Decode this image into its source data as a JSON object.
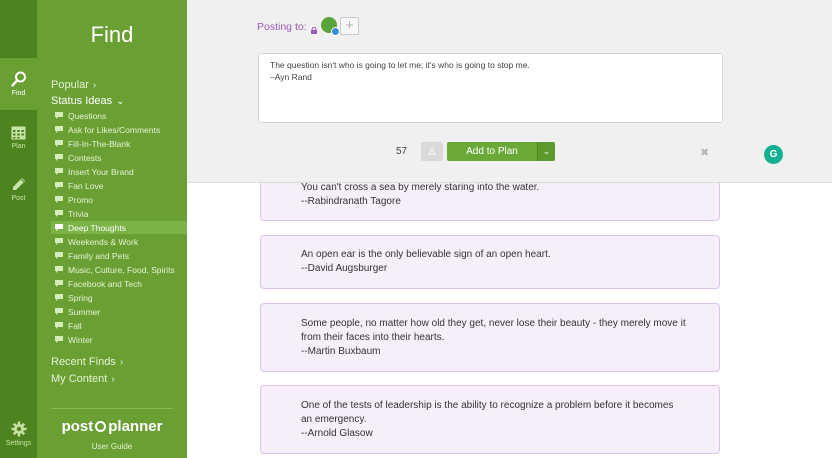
{
  "rail": {
    "items": [
      {
        "label": "Find",
        "icon": "search-icon",
        "active": true
      },
      {
        "label": "Plan",
        "icon": "calendar-icon",
        "active": false
      },
      {
        "label": "Post",
        "icon": "pencil-icon",
        "active": false
      }
    ],
    "settings_label": "Settings"
  },
  "sidebar": {
    "title": "Find",
    "popular": "Popular",
    "status_ideas": "Status Ideas",
    "categories": [
      "Questions",
      "Ask for Likes/Comments",
      "Fill-In-The-Blank",
      "Contests",
      "Insert Your Brand",
      "Fan Love",
      "Promo",
      "Trivia",
      "Deep Thoughts",
      "Weekends & Work",
      "Family and Pets",
      "Music, Culture, Food, Spirits",
      "Facebook and Tech",
      "Spring",
      "Summer",
      "Fall",
      "Winter"
    ],
    "active_category": "Deep Thoughts",
    "recent_finds": "Recent Finds",
    "my_content": "My Content",
    "logo_left": "post",
    "logo_right": "planner",
    "user_guide": "User Guide"
  },
  "composer": {
    "posting_to": "Posting to:",
    "add_profile_symbol": "+",
    "text_line1": "The question isn't who is going to let me; it's who is going to stop me.",
    "text_line2": "–Ayn Rand",
    "char_count": "57",
    "add_to_plan": "Add to Plan",
    "close_symbol": "✖"
  },
  "cards": [
    {
      "lines": [
        "You can't cross a sea by merely staring into the water.",
        "--Rabindranath Tagore"
      ]
    },
    {
      "lines": [
        "An open ear is the only believable sign of an open heart.",
        "--David Augsburger"
      ]
    },
    {
      "lines": [
        "Some people, no matter how old they get, never lose their beauty - they merely move it",
        "from their faces into their hearts.",
        "--Martin Buxbaum"
      ]
    },
    {
      "lines": [
        "One of the tests of leadership is the ability to recognize a problem before it becomes",
        "an emergency.",
        "--Arnold Glasow"
      ]
    }
  ],
  "colors": {
    "rail": "#4e8420",
    "sidebar": "#6a9f34",
    "accent_purple": "#9b5bb3",
    "button_green": "#6aa838"
  }
}
